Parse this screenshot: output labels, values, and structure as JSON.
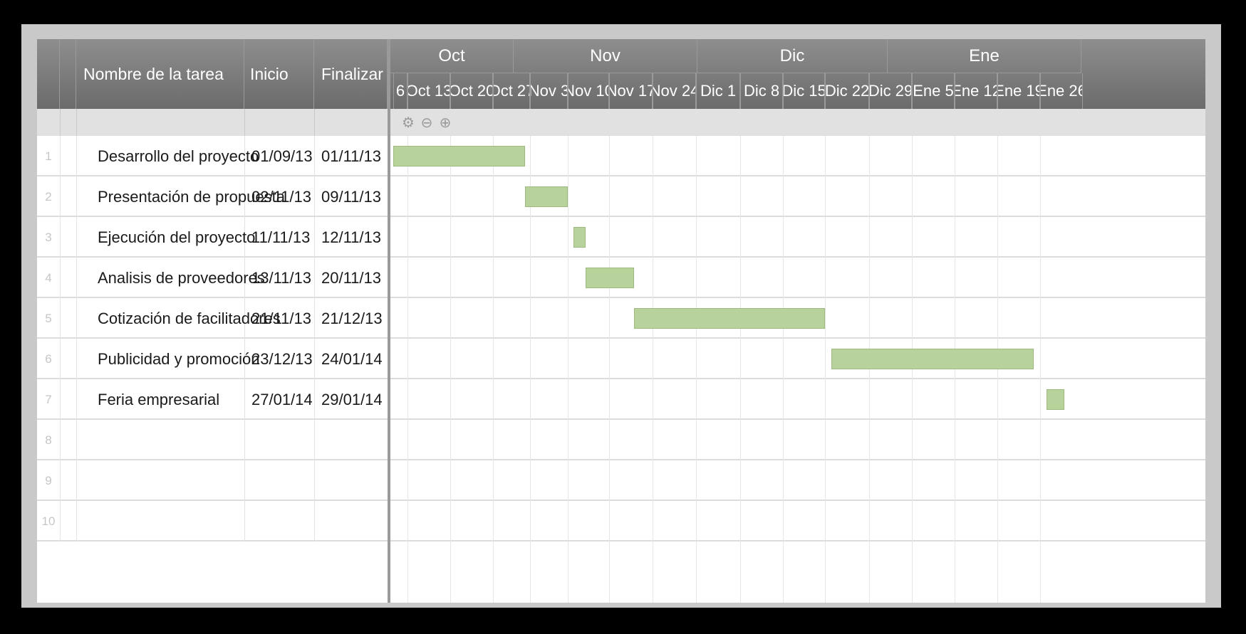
{
  "table": {
    "headers": {
      "name": "Nombre de la tarea",
      "start": "Inicio",
      "end": "Finalizar"
    },
    "rows": [
      {
        "num": "1",
        "name": "Desarrollo del proyecto",
        "start": "01/09/13",
        "end": "01/11/13"
      },
      {
        "num": "2",
        "name": "Presentación de propuesta",
        "start": "02/11/13",
        "end": "09/11/13"
      },
      {
        "num": "3",
        "name": "Ejecución del proyecto",
        "start": "11/11/13",
        "end": "12/11/13"
      },
      {
        "num": "4",
        "name": "Analisis de proveedores",
        "start": "13/11/13",
        "end": "20/11/13"
      },
      {
        "num": "5",
        "name": "Cotización de facilitadores",
        "start": "21/11/13",
        "end": "21/12/13"
      },
      {
        "num": "6",
        "name": "Publicidad y promoción",
        "start": "23/12/13",
        "end": "24/01/14"
      },
      {
        "num": "7",
        "name": "Feria empresarial",
        "start": "27/01/14",
        "end": "29/01/14"
      },
      {
        "num": "8",
        "name": "",
        "start": "",
        "end": ""
      },
      {
        "num": "9",
        "name": "",
        "start": "",
        "end": ""
      },
      {
        "num": "10",
        "name": "",
        "start": "",
        "end": ""
      }
    ]
  },
  "gantt": {
    "months": [
      "Oct",
      "Nov",
      "Dic",
      "Ene"
    ],
    "weeks": [
      "6",
      "Oct 13",
      "Oct 20",
      "Oct 27",
      "Nov 3",
      "Nov 10",
      "Nov 17",
      "Nov 24",
      "Dic 1",
      "Dic 8",
      "Dic 15",
      "Dic 22",
      "Dic 29",
      "Ene 5",
      "Ene 12",
      "Ene 19",
      "Ene 26"
    ],
    "toolbar_icons": [
      "gear-icon",
      "zoom-out-icon",
      "zoom-in-icon"
    ],
    "bar_color": "#b7d29a"
  }
}
